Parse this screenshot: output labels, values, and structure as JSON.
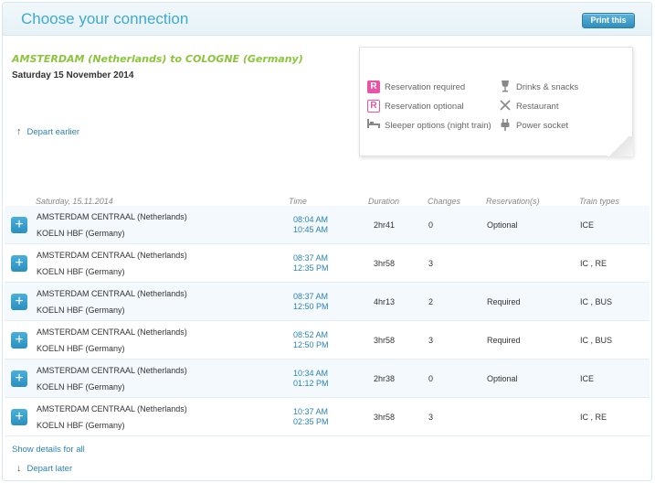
{
  "header": {
    "title": "Choose your connection",
    "print_label": "Print this"
  },
  "journey": {
    "route": "AMSTERDAM (Netherlands)  to  COLOGNE (Germany)",
    "date": "Saturday 15 November 2014"
  },
  "legend": [
    {
      "icon": "R",
      "label": "Reservation required"
    },
    {
      "icon": "R",
      "label": "Reservation optional"
    },
    {
      "icon": "bed",
      "label": "Sleeper options (night train)"
    },
    {
      "icon": "glass",
      "label": "Drinks & snacks"
    },
    {
      "icon": "cutlery",
      "label": "Restaurant"
    },
    {
      "icon": "plug",
      "label": "Power socket"
    }
  ],
  "links": {
    "depart_earlier": "Depart earlier",
    "show_details": "Show details for all",
    "depart_later": "Depart later"
  },
  "table": {
    "headers": {
      "date": "Saturday, 15.11.2014",
      "time": "Time",
      "duration": "Duration",
      "changes": "Changes",
      "reservations": "Reservation(s)",
      "train_types": "Train types"
    },
    "rows": [
      {
        "from": "AMSTERDAM CENTRAAL (Netherlands)",
        "to": "KOELN HBF (Germany)",
        "dep": "08:04 AM",
        "arr": "10:45 AM",
        "duration": "2hr41",
        "changes": "0",
        "reservation": "Optional",
        "types": "ICE"
      },
      {
        "from": "AMSTERDAM CENTRAAL (Netherlands)",
        "to": "KOELN HBF (Germany)",
        "dep": "08:37 AM",
        "arr": "12:35 PM",
        "duration": "3hr58",
        "changes": "3",
        "reservation": "",
        "types": "IC , RE"
      },
      {
        "from": "AMSTERDAM CENTRAAL (Netherlands)",
        "to": "KOELN HBF (Germany)",
        "dep": "08:37 AM",
        "arr": "12:50 PM",
        "duration": "4hr13",
        "changes": "2",
        "reservation": "Required",
        "types": "IC , BUS"
      },
      {
        "from": "AMSTERDAM CENTRAAL (Netherlands)",
        "to": "KOELN HBF (Germany)",
        "dep": "08:52 AM",
        "arr": "12:50 PM",
        "duration": "3hr58",
        "changes": "3",
        "reservation": "Required",
        "types": "IC , BUS"
      },
      {
        "from": "AMSTERDAM CENTRAAL (Netherlands)",
        "to": "KOELN HBF (Germany)",
        "dep": "10:34 AM",
        "arr": "01:12 PM",
        "duration": "2hr38",
        "changes": "0",
        "reservation": "Optional",
        "types": "ICE"
      },
      {
        "from": "AMSTERDAM CENTRAAL (Netherlands)",
        "to": "KOELN HBF (Germany)",
        "dep": "10:37 AM",
        "arr": "02:35 PM",
        "duration": "3hr58",
        "changes": "3",
        "reservation": "",
        "types": "IC , RE"
      }
    ]
  },
  "colors": {
    "accent": "#3fa9d1",
    "route": "#8cc43d",
    "reservation": "#e754a5",
    "link": "#2a83b5"
  }
}
